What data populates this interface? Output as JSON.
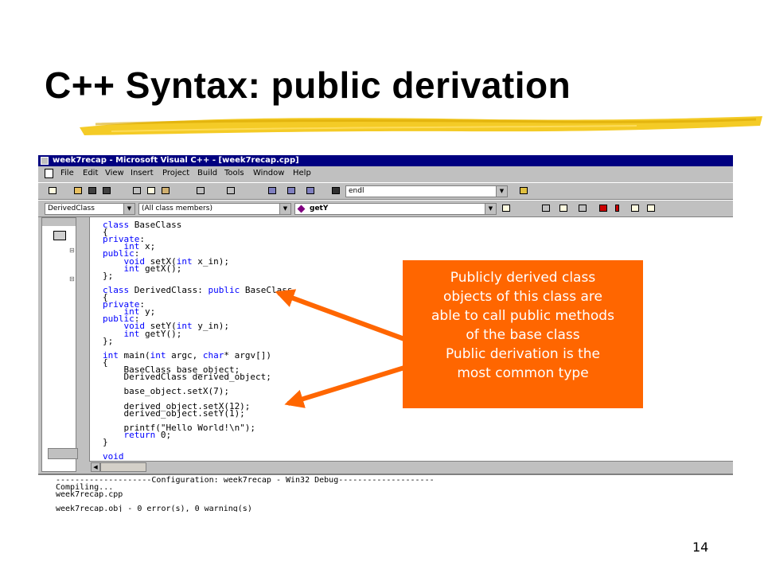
{
  "slide": {
    "title": "C++ Syntax: public derivation",
    "page_number": "14"
  },
  "ide": {
    "window_title": "week7recap - Microsoft Visual C++ - [week7recap.cpp]",
    "menus": [
      "File",
      "Edit",
      "View",
      "Insert",
      "Project",
      "Build",
      "Tools",
      "Window",
      "Help"
    ],
    "find_combo_value": "endl",
    "class_combo_value": "DerivedClass",
    "members_combo_value": "(All class members)",
    "function_combo_value": "getY",
    "code_lines": [
      "class BaseClass",
      "{",
      "private:",
      "    int x;",
      "public:",
      "    void setX(int x_in);",
      "    int getX();",
      "};",
      "",
      "class DerivedClass: public BaseClass",
      "{",
      "private:",
      "    int y;",
      "public:",
      "    void setY(int y_in);",
      "    int getY();",
      "};",
      "",
      "int main(int argc, char* argv[])",
      "{",
      "    BaseClass base_object;",
      "    DerivedClass derived_object;",
      "",
      "    base_object.setX(7);",
      "",
      "    derived_object.setX(12);",
      "    derived_object.setY(1);",
      "",
      "    printf(\"Hello World!\\n\");",
      "    return 0;",
      "}",
      "",
      "void"
    ],
    "output_lines": [
      "--------------------Configuration: week7recap - Win32 Debug--------------------",
      "Compiling...",
      "week7recap.cpp",
      "",
      "week7recap.obj - 0 error(s), 0 warning(s)"
    ]
  },
  "callout": {
    "lines": [
      "Publicly derived class",
      "objects of this class are",
      "able to call public methods",
      "of the base class",
      "Public derivation is the",
      "most common type"
    ]
  },
  "colors": {
    "callout_fill": "#ff6600",
    "arrow": "#ff6600",
    "underline_stroke": "#f2c200",
    "ide_titlebar": "#000080",
    "keyword": "#0000ff"
  },
  "icons": {
    "title_bar": "app-window-icon",
    "find": "binoculars-icon",
    "function_combo": "function-diamond-icon"
  }
}
